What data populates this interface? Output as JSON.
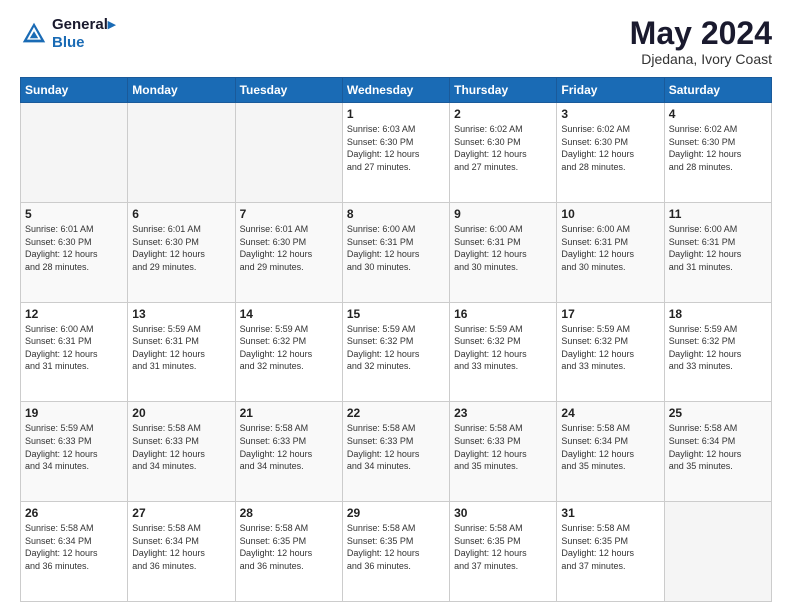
{
  "logo": {
    "line1": "General",
    "line2": "Blue"
  },
  "title": "May 2024",
  "subtitle": "Djedana, Ivory Coast",
  "days_of_week": [
    "Sunday",
    "Monday",
    "Tuesday",
    "Wednesday",
    "Thursday",
    "Friday",
    "Saturday"
  ],
  "weeks": [
    [
      {
        "day": "",
        "info": ""
      },
      {
        "day": "",
        "info": ""
      },
      {
        "day": "",
        "info": ""
      },
      {
        "day": "1",
        "info": "Sunrise: 6:03 AM\nSunset: 6:30 PM\nDaylight: 12 hours\nand 27 minutes."
      },
      {
        "day": "2",
        "info": "Sunrise: 6:02 AM\nSunset: 6:30 PM\nDaylight: 12 hours\nand 27 minutes."
      },
      {
        "day": "3",
        "info": "Sunrise: 6:02 AM\nSunset: 6:30 PM\nDaylight: 12 hours\nand 28 minutes."
      },
      {
        "day": "4",
        "info": "Sunrise: 6:02 AM\nSunset: 6:30 PM\nDaylight: 12 hours\nand 28 minutes."
      }
    ],
    [
      {
        "day": "5",
        "info": "Sunrise: 6:01 AM\nSunset: 6:30 PM\nDaylight: 12 hours\nand 28 minutes."
      },
      {
        "day": "6",
        "info": "Sunrise: 6:01 AM\nSunset: 6:30 PM\nDaylight: 12 hours\nand 29 minutes."
      },
      {
        "day": "7",
        "info": "Sunrise: 6:01 AM\nSunset: 6:30 PM\nDaylight: 12 hours\nand 29 minutes."
      },
      {
        "day": "8",
        "info": "Sunrise: 6:00 AM\nSunset: 6:31 PM\nDaylight: 12 hours\nand 30 minutes."
      },
      {
        "day": "9",
        "info": "Sunrise: 6:00 AM\nSunset: 6:31 PM\nDaylight: 12 hours\nand 30 minutes."
      },
      {
        "day": "10",
        "info": "Sunrise: 6:00 AM\nSunset: 6:31 PM\nDaylight: 12 hours\nand 30 minutes."
      },
      {
        "day": "11",
        "info": "Sunrise: 6:00 AM\nSunset: 6:31 PM\nDaylight: 12 hours\nand 31 minutes."
      }
    ],
    [
      {
        "day": "12",
        "info": "Sunrise: 6:00 AM\nSunset: 6:31 PM\nDaylight: 12 hours\nand 31 minutes."
      },
      {
        "day": "13",
        "info": "Sunrise: 5:59 AM\nSunset: 6:31 PM\nDaylight: 12 hours\nand 31 minutes."
      },
      {
        "day": "14",
        "info": "Sunrise: 5:59 AM\nSunset: 6:32 PM\nDaylight: 12 hours\nand 32 minutes."
      },
      {
        "day": "15",
        "info": "Sunrise: 5:59 AM\nSunset: 6:32 PM\nDaylight: 12 hours\nand 32 minutes."
      },
      {
        "day": "16",
        "info": "Sunrise: 5:59 AM\nSunset: 6:32 PM\nDaylight: 12 hours\nand 33 minutes."
      },
      {
        "day": "17",
        "info": "Sunrise: 5:59 AM\nSunset: 6:32 PM\nDaylight: 12 hours\nand 33 minutes."
      },
      {
        "day": "18",
        "info": "Sunrise: 5:59 AM\nSunset: 6:32 PM\nDaylight: 12 hours\nand 33 minutes."
      }
    ],
    [
      {
        "day": "19",
        "info": "Sunrise: 5:59 AM\nSunset: 6:33 PM\nDaylight: 12 hours\nand 34 minutes."
      },
      {
        "day": "20",
        "info": "Sunrise: 5:58 AM\nSunset: 6:33 PM\nDaylight: 12 hours\nand 34 minutes."
      },
      {
        "day": "21",
        "info": "Sunrise: 5:58 AM\nSunset: 6:33 PM\nDaylight: 12 hours\nand 34 minutes."
      },
      {
        "day": "22",
        "info": "Sunrise: 5:58 AM\nSunset: 6:33 PM\nDaylight: 12 hours\nand 34 minutes."
      },
      {
        "day": "23",
        "info": "Sunrise: 5:58 AM\nSunset: 6:33 PM\nDaylight: 12 hours\nand 35 minutes."
      },
      {
        "day": "24",
        "info": "Sunrise: 5:58 AM\nSunset: 6:34 PM\nDaylight: 12 hours\nand 35 minutes."
      },
      {
        "day": "25",
        "info": "Sunrise: 5:58 AM\nSunset: 6:34 PM\nDaylight: 12 hours\nand 35 minutes."
      }
    ],
    [
      {
        "day": "26",
        "info": "Sunrise: 5:58 AM\nSunset: 6:34 PM\nDaylight: 12 hours\nand 36 minutes."
      },
      {
        "day": "27",
        "info": "Sunrise: 5:58 AM\nSunset: 6:34 PM\nDaylight: 12 hours\nand 36 minutes."
      },
      {
        "day": "28",
        "info": "Sunrise: 5:58 AM\nSunset: 6:35 PM\nDaylight: 12 hours\nand 36 minutes."
      },
      {
        "day": "29",
        "info": "Sunrise: 5:58 AM\nSunset: 6:35 PM\nDaylight: 12 hours\nand 36 minutes."
      },
      {
        "day": "30",
        "info": "Sunrise: 5:58 AM\nSunset: 6:35 PM\nDaylight: 12 hours\nand 37 minutes."
      },
      {
        "day": "31",
        "info": "Sunrise: 5:58 AM\nSunset: 6:35 PM\nDaylight: 12 hours\nand 37 minutes."
      },
      {
        "day": "",
        "info": ""
      }
    ]
  ]
}
